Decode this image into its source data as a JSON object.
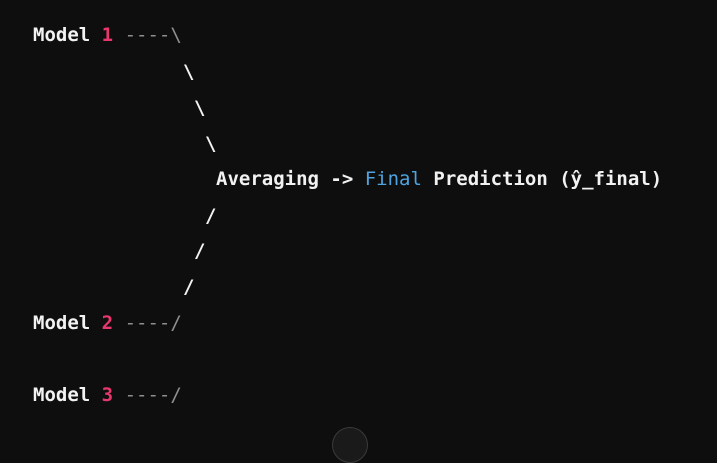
{
  "code": {
    "line1": {
      "model": "Model",
      "num": "1",
      "arrow": "----\\"
    },
    "line2": {
      "slash": "\\"
    },
    "line3": {
      "slash": "\\"
    },
    "line4": {
      "slash": "\\"
    },
    "line5": {
      "avg": "Averaging ->",
      "final": "Final",
      "pred": "Prediction (ŷ_final)"
    },
    "line6": {
      "slash": "/"
    },
    "line7": {
      "slash": "/"
    },
    "line8": {
      "slash": "/"
    },
    "line9": {
      "model": "Model",
      "num": "2",
      "arrow": "----/"
    },
    "line10": {
      "model": "Model",
      "num": "3",
      "arrow": "----/"
    }
  }
}
